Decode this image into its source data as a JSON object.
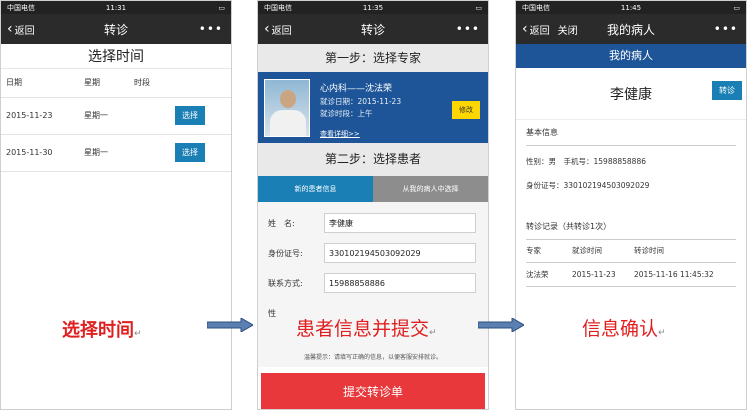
{
  "screens": [
    {
      "status": {
        "carrier": "中国电信",
        "time": "11:31"
      },
      "nav": {
        "back": "返回",
        "title": "转诊",
        "more": "•••"
      },
      "heading": "选择时间",
      "columns": [
        "日期",
        "星期",
        "时段"
      ],
      "rows": [
        {
          "date": "2015-11-23",
          "weekday": "星期一",
          "action": "选择"
        },
        {
          "date": "2015-11-30",
          "weekday": "星期一",
          "action": "选择"
        }
      ]
    },
    {
      "status": {
        "carrier": "中国电信",
        "time": "11:35"
      },
      "nav": {
        "back": "返回",
        "title": "转诊",
        "more": "•••"
      },
      "step1": "第一步：选择专家",
      "doctor": {
        "name": "心内科——沈法荣",
        "date_line": "就诊日期：2015-11-23",
        "period_line": "就诊时段：上午",
        "detail_link": "查看详细>>",
        "edit": "修改"
      },
      "step2": "第二步：选择患者",
      "tabs": [
        "新的患者信息",
        "从我的病人中选择"
      ],
      "form": {
        "name_label": "姓　名:",
        "name_value": "李健康",
        "id_label": "身份证号:",
        "id_value": "330102194503092029",
        "phone_label": "联系方式:",
        "phone_value": "15988858886",
        "sex_label": "性"
      },
      "hint": "温馨提示：请填写正确的信息，以便客服安排就诊。",
      "submit": "提交转诊单"
    },
    {
      "status": {
        "carrier": "中国电信",
        "time": "11:45"
      },
      "nav": {
        "back": "返回",
        "close": "关闭",
        "title": "我的病人",
        "more": "•••"
      },
      "bar_title": "我的病人",
      "patient_name": "李健康",
      "transfer_btn": "转诊",
      "basic_label": "基本信息",
      "sex_line": "性别：男　手机号：15988858886",
      "id_line": "身份证号：330102194503092029",
      "history_label": "转诊记录（共转诊1次）",
      "history_cols": [
        "专家",
        "就诊时间",
        "转诊时间"
      ],
      "history_rows": [
        {
          "expert": "沈法荣",
          "visit": "2015-11-23",
          "transfer": "2015-11-16 11:45:32"
        }
      ]
    }
  ],
  "annotations": {
    "a1": "选择时间",
    "a2": "患者信息并提交",
    "a3": "信息确认",
    "mark": "↵"
  },
  "colors": {
    "accent_blue": "#1a7fb5",
    "card_blue": "#1e5598",
    "submit_red": "#e8383b",
    "annotation_red": "#e02020",
    "edit_yellow": "#ffd700"
  }
}
